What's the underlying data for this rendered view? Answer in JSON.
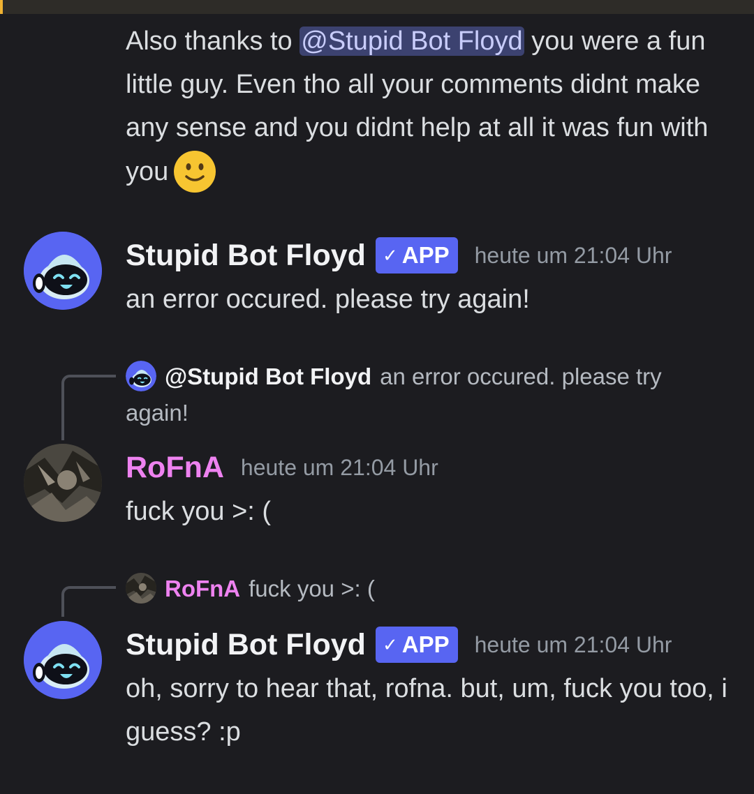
{
  "continued_message": {
    "before_mention": "Also thanks to ",
    "mention": "@Stupid Bot Floyd",
    "after_mention": " you were a fun little guy. Even tho all your comments didnt make any sense and you didnt help at all it was fun with you",
    "emoji": "slightly-smiling-face"
  },
  "messages": [
    {
      "author": "Stupid Bot Floyd",
      "badge": "APP",
      "timestamp": "heute um 21:04 Uhr",
      "content": "an error occured. please try again!"
    },
    {
      "reply_to": {
        "author": "@Stupid Bot Floyd",
        "content": "an error occured. please try again!"
      },
      "author": "RoFnA",
      "timestamp": "heute um 21:04 Uhr",
      "content": "fuck you >: ("
    },
    {
      "reply_to": {
        "author": "RoFnA",
        "content": "fuck you >: ("
      },
      "author": "Stupid Bot Floyd",
      "badge": "APP",
      "timestamp": "heute um 21:04 Uhr",
      "content": "oh, sorry to hear that, rofna. but, um, fuck you too, i guess? :p"
    }
  ],
  "colors": {
    "background": "#1c1c20",
    "bot_avatar": "#5865f2",
    "app_badge": "#5865f2",
    "rofna_name": "#ee82f0",
    "mention_bg": "#3c4270",
    "timestamp": "#949ba4"
  }
}
